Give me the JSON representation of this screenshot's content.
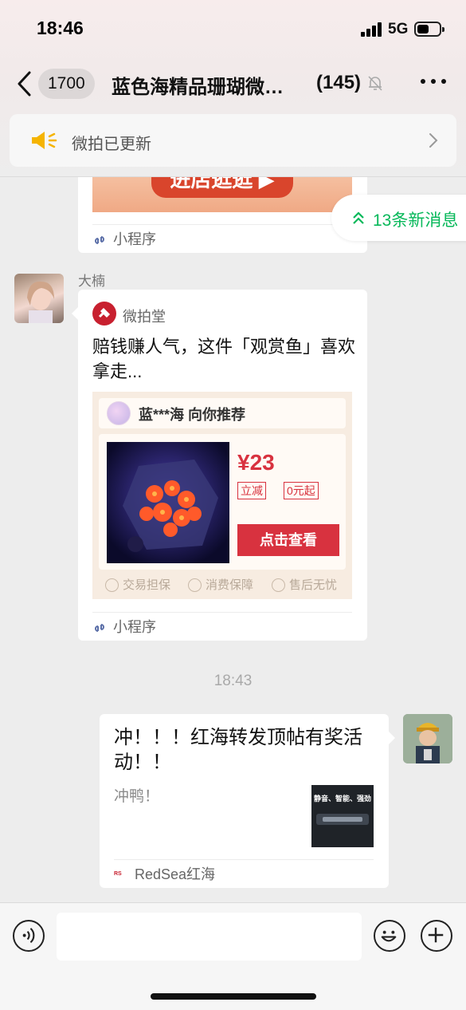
{
  "status_bar": {
    "time": "18:46",
    "network": "5G",
    "battery_level": 0.55
  },
  "nav": {
    "back_unread_count": "1700",
    "chat_title": "蓝色海精品珊瑚微…",
    "member_count": "(145)"
  },
  "notice": {
    "text": "微拍已更新"
  },
  "new_messages": {
    "label": "13条新消息"
  },
  "messages": [
    {
      "type": "mini_program_card_partial",
      "promo_button": "进店逛逛 ▶",
      "footer": "小程序"
    },
    {
      "type": "mini_program_card",
      "sender": "大楠",
      "source_name": "微拍堂",
      "title": "赔钱赚人气，这件「观赏鱼」喜欢拿走...",
      "recommend_text": "蓝***海 向你推荐",
      "price": "¥23",
      "tags": [
        "立减",
        "0元起"
      ],
      "button": "点击查看",
      "guarantees": [
        "交易担保",
        "消费保障",
        "售后无忧"
      ],
      "footer": "小程序"
    },
    {
      "type": "time_divider",
      "time": "18:43"
    },
    {
      "type": "article_card",
      "title": "冲！！！红海转发顶帖有奖活动！！",
      "description": "冲鸭！",
      "thumb_text": "静音、智能、强劲",
      "source": "RedSea红海"
    }
  ],
  "icons": {
    "back": "chevron-left-icon",
    "mute": "bell-slash-icon",
    "more": "ellipsis-icon",
    "notice": "megaphone-icon",
    "mini_program": "mini-program-icon",
    "voice": "voice-icon",
    "emoji": "emoji-icon",
    "plus": "plus-icon"
  },
  "colors": {
    "accent_green": "#07b85a",
    "brand_red": "#d8323f",
    "notice_yellow": "#f5b400"
  }
}
